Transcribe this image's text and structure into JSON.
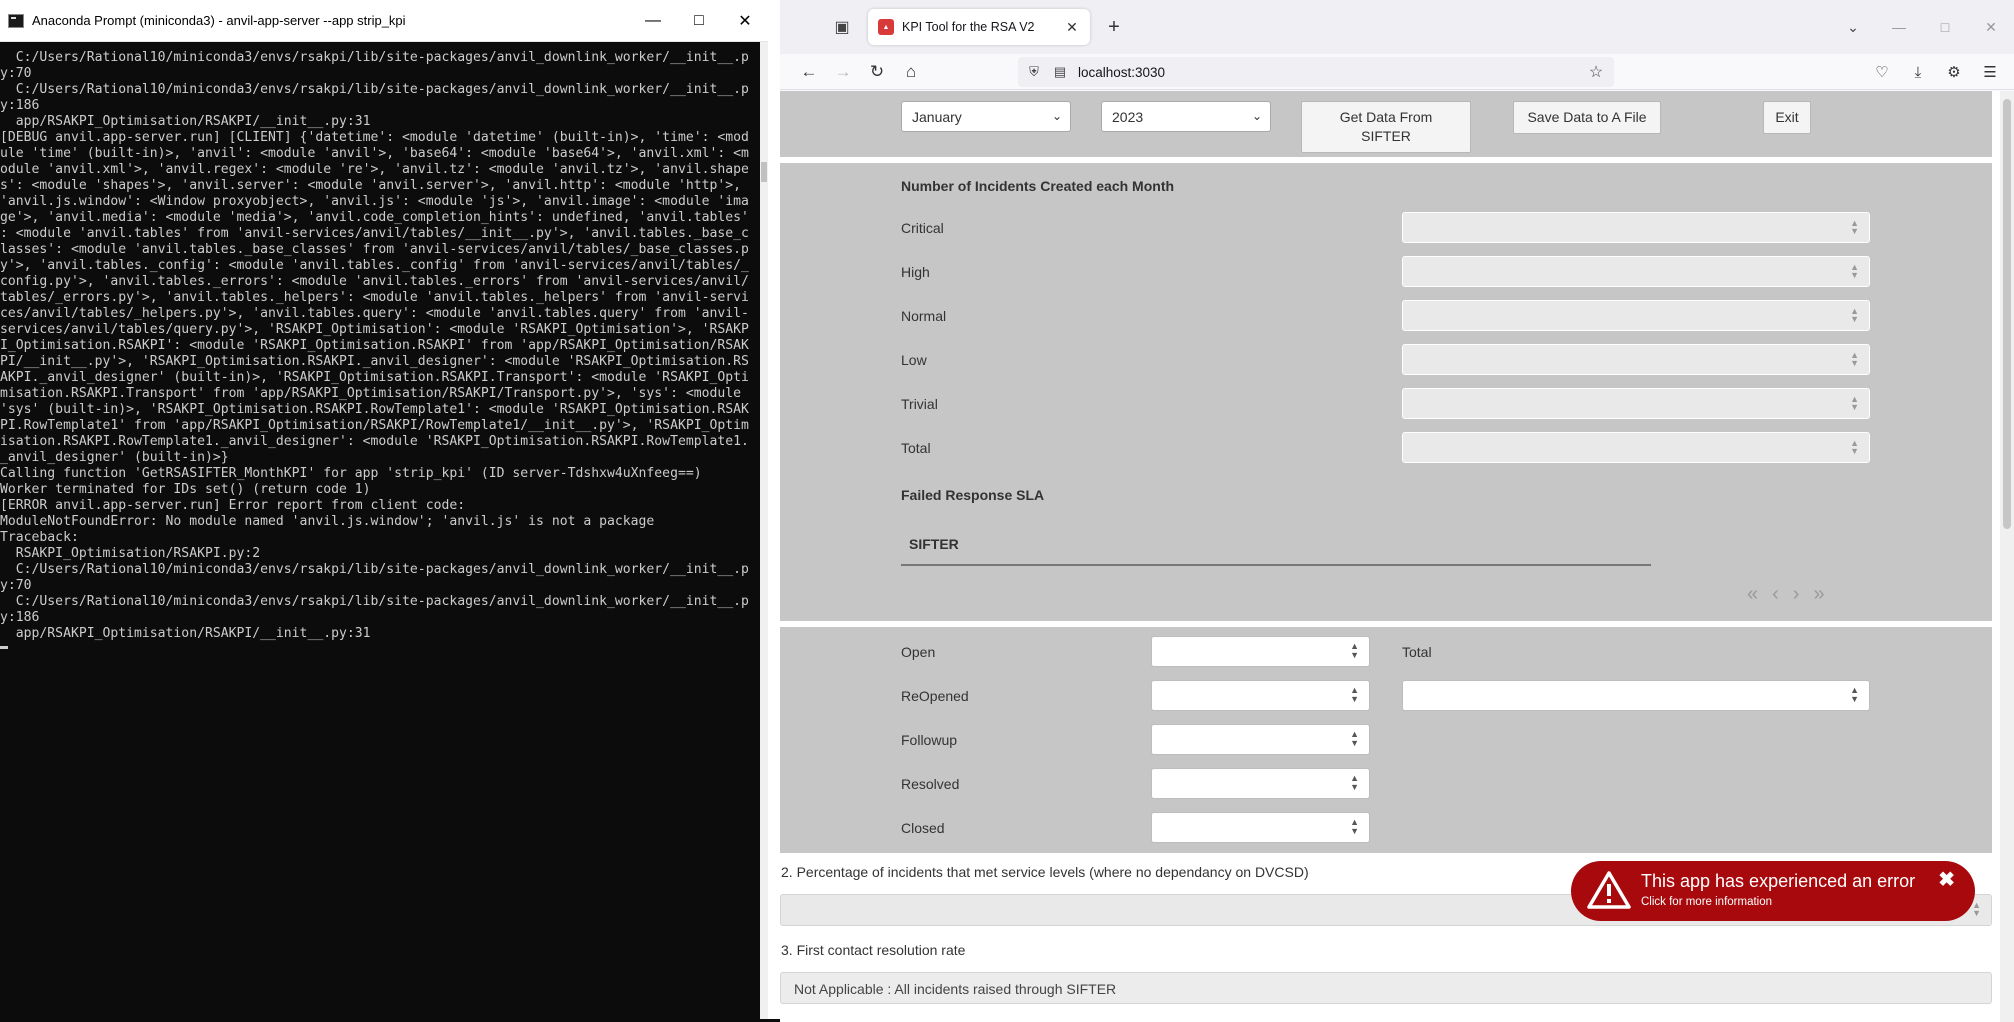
{
  "terminal": {
    "title": "Anaconda Prompt (miniconda3) - anvil-app-server  --app strip_kpi",
    "lines": [
      "",
      "  C:/Users/Rational10/miniconda3/envs/rsakpi/lib/site-packages/anvil_downlink_worker/__init__.p",
      "y:70",
      "",
      "  C:/Users/Rational10/miniconda3/envs/rsakpi/lib/site-packages/anvil_downlink_worker/__init__.p",
      "y:186",
      "",
      "  app/RSAKPI_Optimisation/RSAKPI/__init__.py:31",
      "",
      "[DEBUG anvil.app-server.run] [CLIENT] {'datetime': <module 'datetime' (built-in)>, 'time': <mod",
      "ule 'time' (built-in)>, 'anvil': <module 'anvil'>, 'base64': <module 'base64'>, 'anvil.xml': <m",
      "odule 'anvil.xml'>, 'anvil.regex': <module 're'>, 'anvil.tz': <module 'anvil.tz'>, 'anvil.shape",
      "s': <module 'shapes'>, 'anvil.server': <module 'anvil.server'>, 'anvil.http': <module 'http'>,",
      "'anvil.js.window': <Window proxyobject>, 'anvil.js': <module 'js'>, 'anvil.image': <module 'ima",
      "ge'>, 'anvil.media': <module 'media'>, 'anvil.code_completion_hints': undefined, 'anvil.tables'",
      ": <module 'anvil.tables' from 'anvil-services/anvil/tables/__init__.py'>, 'anvil.tables._base_c",
      "lasses': <module 'anvil.tables._base_classes' from 'anvil-services/anvil/tables/_base_classes.p",
      "y'>, 'anvil.tables._config': <module 'anvil.tables._config' from 'anvil-services/anvil/tables/_",
      "config.py'>, 'anvil.tables._errors': <module 'anvil.tables._errors' from 'anvil-services/anvil/",
      "tables/_errors.py'>, 'anvil.tables._helpers': <module 'anvil.tables._helpers' from 'anvil-servi",
      "ces/anvil/tables/_helpers.py'>, 'anvil.tables.query': <module 'anvil.tables.query' from 'anvil-",
      "services/anvil/tables/query.py'>, 'RSAKPI_Optimisation': <module 'RSAKPI_Optimisation'>, 'RSAKP",
      "I_Optimisation.RSAKPI': <module 'RSAKPI_Optimisation.RSAKPI' from 'app/RSAKPI_Optimisation/RSAK",
      "PI/__init__.py'>, 'RSAKPI_Optimisation.RSAKPI._anvil_designer': <module 'RSAKPI_Optimisation.RS",
      "AKPI._anvil_designer' (built-in)>, 'RSAKPI_Optimisation.RSAKPI.Transport': <module 'RSAKPI_Opti",
      "misation.RSAKPI.Transport' from 'app/RSAKPI_Optimisation/RSAKPI/Transport.py'>, 'sys': <module",
      "'sys' (built-in)>, 'RSAKPI_Optimisation.RSAKPI.RowTemplate1': <module 'RSAKPI_Optimisation.RSAK",
      "PI.RowTemplate1' from 'app/RSAKPI_Optimisation/RSAKPI/RowTemplate1/__init__.py'>, 'RSAKPI_Optim",
      "isation.RSAKPI.RowTemplate1._anvil_designer': <module 'RSAKPI_Optimisation.RSAKPI.RowTemplate1.",
      "_anvil_designer' (built-in)>}",
      "Calling function 'GetRSASIFTER_MonthKPI' for app 'strip_kpi' (ID server-Tdshxw4uXnfeeg==)",
      "Worker terminated for IDs set() (return code 1)",
      "[ERROR anvil.app-server.run] Error report from client code:",
      "ModuleNotFoundError: No module named 'anvil.js.window'; 'anvil.js' is not a package",
      "Traceback:",
      "  RSAKPI_Optimisation/RSAKPI.py:2",
      "",
      "  C:/Users/Rational10/miniconda3/envs/rsakpi/lib/site-packages/anvil_downlink_worker/__init__.p",
      "y:70",
      "",
      "  C:/Users/Rational10/miniconda3/envs/rsakpi/lib/site-packages/anvil_downlink_worker/__init__.p",
      "y:186",
      "",
      "  app/RSAKPI_Optimisation/RSAKPI/__init__.py:31",
      ""
    ]
  },
  "browser": {
    "tab_title": "KPI Tool for the RSA V2",
    "url": "localhost:3030"
  },
  "page": {
    "month_select": "January",
    "year_select": "2023",
    "get_data_button": "Get Data From SIFTER",
    "save_button": "Save Data to A File",
    "exit_button": "Exit",
    "incidents_heading": "Number of Incidents Created each Month",
    "priorities": [
      "Critical",
      "High",
      "Normal",
      "Low",
      "Trivial",
      "Total"
    ],
    "failed_sla_heading": "Failed Response SLA",
    "sifter_column": "SIFTER",
    "statuses": [
      "Open",
      "ReOpened",
      "Followup",
      "Resolved",
      "Closed"
    ],
    "total_label": "Total",
    "section2_label": "2. Percentage of incidents that met service levels (where no dependancy on DVCSD)",
    "section3_label": "3. First contact resolution rate",
    "not_applicable_text": "Not Applicable : All incidents raised through SIFTER"
  },
  "error_toast": {
    "title": "This app has experienced an error",
    "subtitle": "Click for more information"
  }
}
